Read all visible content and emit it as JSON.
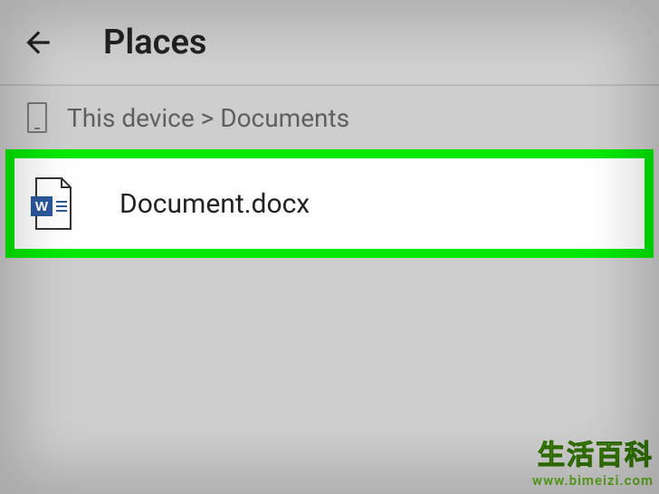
{
  "header": {
    "title": "Places"
  },
  "breadcrumb": {
    "text": "This device > Documents"
  },
  "file": {
    "name": "Document.docx"
  },
  "watermark": {
    "cn": "生活百科",
    "url": "www.bimeizi.com"
  }
}
